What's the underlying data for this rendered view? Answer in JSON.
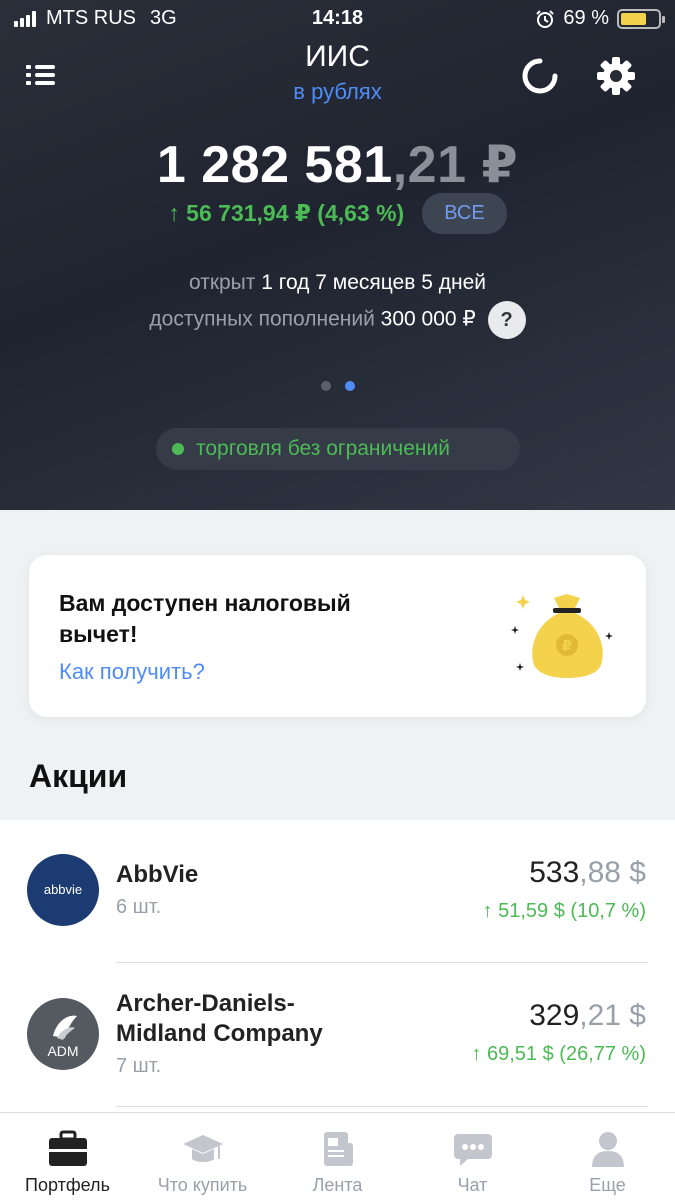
{
  "status": {
    "carrier": "MTS RUS",
    "network": "3G",
    "time": "14:18",
    "battery": "69 %",
    "battery_level": 0.69
  },
  "header": {
    "title": "ИИС",
    "subtitle": "в рублях"
  },
  "balance": {
    "main": "1 282 581",
    "cents": ",21 ₽"
  },
  "gain": {
    "text": "↑ 56 731,94 ₽ (4,63 %)",
    "all_label": "ВСЕ"
  },
  "info": {
    "opened_label": "открыт",
    "opened_value": "1 год 7 месяцев 5 дней",
    "deposits_label": "доступных пополнений",
    "deposits_value": "300 000 ₽",
    "help": "?"
  },
  "trading_status": "торговля без ограничений",
  "tax_card": {
    "title": "Вам доступен налоговый вычет!",
    "link": "Как получить?",
    "coin_symbol": "₽"
  },
  "section": {
    "title": "Акции"
  },
  "stocks": [
    {
      "logo_text": "abbvie",
      "name": "AbbVie",
      "qty": "6 шт.",
      "price_main": "533",
      "price_cents": ",88 $",
      "change": "↑ 51,59 $ (10,7 %)"
    },
    {
      "logo_text": "ADM",
      "name": "Archer-Daniels-Midland Company",
      "qty": "7 шт.",
      "price_main": "329",
      "price_cents": ",21 $",
      "change": "↑ 69,51 $ (26,77 %)"
    }
  ],
  "tabs": [
    {
      "label": "Портфель",
      "icon": "briefcase-icon",
      "active": true
    },
    {
      "label": "Что купить",
      "icon": "graduation-cap-icon",
      "active": false
    },
    {
      "label": "Лента",
      "icon": "news-icon",
      "active": false
    },
    {
      "label": "Чат",
      "icon": "chat-icon",
      "active": false
    },
    {
      "label": "Еще",
      "icon": "user-icon",
      "active": false
    }
  ],
  "colors": {
    "accent": "#4f8cf5",
    "positive": "#4cba55",
    "hero_bg": "#1f2430"
  }
}
